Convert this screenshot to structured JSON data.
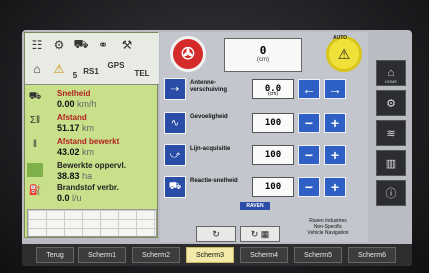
{
  "left_panel": {
    "badge": "5",
    "top_labels": {
      "rsi": "RS1",
      "gps": "GPS",
      "tel": "TEL"
    },
    "stats": [
      {
        "label": "Snelheid",
        "value": "0.00",
        "unit": "km/h",
        "icon": "tractor-icon"
      },
      {
        "label": "Afstand",
        "value": "51.17",
        "unit": "km",
        "icon": "distance-icon"
      },
      {
        "label": "Afstand bewerkt",
        "value": "43.02",
        "unit": "km",
        "icon": "distance-worked-icon"
      },
      {
        "label": "Bewerkte oppervl.",
        "value": "38.83",
        "unit": "ha",
        "icon": "area-icon"
      },
      {
        "label": "Brandstof verbr.",
        "value": "0.0",
        "unit": "l/u",
        "icon": "fuel-icon"
      }
    ]
  },
  "center": {
    "display": {
      "value": "0",
      "unit": "(cm)"
    },
    "auto_badge": "AUTO",
    "rows": [
      {
        "label": "Antenne-verschuiving",
        "value": "0.0",
        "unit": "(cm)",
        "icon": "antenna-shift-icon",
        "minus": "←",
        "plus": "→"
      },
      {
        "label": "Gevoeligheid",
        "value": "100",
        "icon": "sensitivity-icon",
        "minus": "−",
        "plus": "+"
      },
      {
        "label": "Lijn-acquisitie",
        "value": "100",
        "icon": "line-acquisition-icon",
        "minus": "−",
        "plus": "+"
      },
      {
        "label": "Reactie-snelheid",
        "value": "100",
        "icon": "reaction-speed-icon",
        "minus": "−",
        "plus": "+"
      }
    ],
    "brand": "RAVEN",
    "credits": [
      "Raven Industries",
      "Non-Specific",
      "Vehicle Navigation"
    ]
  },
  "right_sidebar": {
    "home_label": "HOME"
  },
  "tabs": [
    {
      "label": "Terug",
      "active": false
    },
    {
      "label": "Scherm1",
      "active": false
    },
    {
      "label": "Scherm2",
      "active": false
    },
    {
      "label": "Scherm3",
      "active": true
    },
    {
      "label": "Scherm4",
      "active": false
    },
    {
      "label": "Scherm5",
      "active": false
    },
    {
      "label": "Scherm6",
      "active": false
    }
  ]
}
